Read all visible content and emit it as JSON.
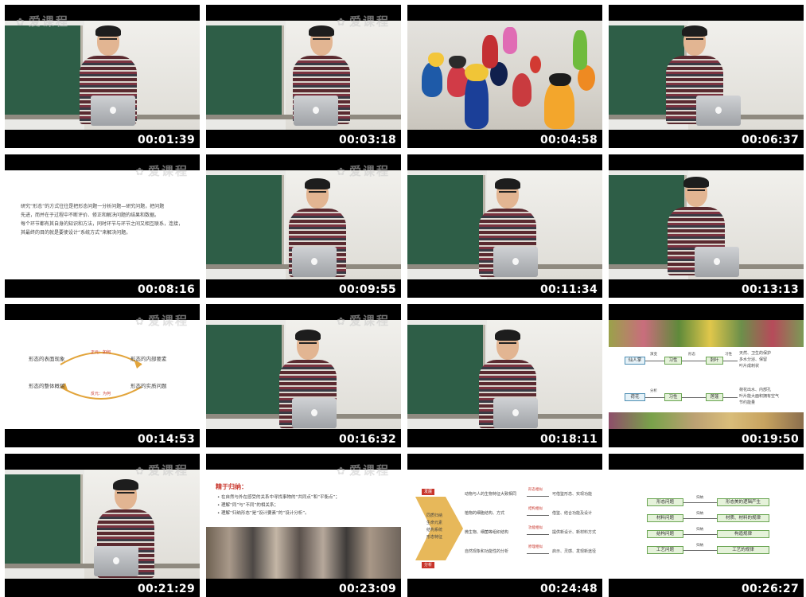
{
  "watermark": "爱课程",
  "timestamps": [
    "00:01:39",
    "00:03:18",
    "00:04:58",
    "00:06:37",
    "00:08:16",
    "00:09:55",
    "00:11:34",
    "00:13:13",
    "00:14:53",
    "00:16:32",
    "00:18:11",
    "00:19:50",
    "00:21:29",
    "00:23:09",
    "00:24:48",
    "00:26:27"
  ],
  "slide_8_16": {
    "lines": [
      "研究“形态”的方式往往是把形态问题一分析问题—研究问题，把问题",
      "先进，而并在于过程中不断评价、修正和解决问题的结果和数据。",
      "每个环节都有其自身的知识和方法，同时环节与环节之间又相互联系，连接，",
      "其最终的目的就是要使设计“系统方式”来解决问题。"
    ]
  },
  "slide_14_53": {
    "left_top": "形态的表面现象",
    "right_top": "形态的内部要素",
    "left_bottom": "形态的整体概貌",
    "right_bottom": "形态的实质问题",
    "arc_top": "正元：如何",
    "arc_bottom": "反元：为何"
  },
  "slide_19_50": {
    "row1": [
      "仙人掌",
      "习性",
      "刺叶"
    ],
    "row1_notes": [
      "天然、卫生的保护",
      "多水分泌、保留",
      "叶片成刺状"
    ],
    "row2": [
      "荷花",
      "习性",
      "莲蓬"
    ],
    "row2_notes": [
      "荷花出水、内部孔",
      "叶片能大面积拥有空气",
      "节约能量"
    ],
    "arrow_labels": [
      "演变",
      "形态",
      "习性",
      "分析"
    ]
  },
  "slide_23_09": {
    "title": "精于归纳：",
    "bullets": [
      "• 在自然与外在感受的关系中寻找事物的“共同点”和“平衡点”；",
      "• 理解“同”与“不同”的相关系；",
      "• 理解“归纳形态”是“设计要素”的“设计分析”。"
    ]
  },
  "slide_24_48": {
    "left_tag_top": "发展",
    "left_tag_bottom": "分析",
    "center_lines": [
      "同质归纳",
      "生命元素",
      "结构系统",
      "形态特征"
    ],
    "rows": [
      {
        "text": "动物与人的生物特征大致相同",
        "tag": "形态相似",
        "result": "可借鉴形态、实现功能"
      },
      {
        "text": "植物的细胞结构、方式",
        "tag": "结构相似",
        "result": "借鉴、结合功能及设计"
      },
      {
        "text": "微生物、细菌等组织结构",
        "tag": "功能相似",
        "result": "提供新设计、新材料方式"
      },
      {
        "text": "自然现象和功能性的分析",
        "tag": "原理相似",
        "result": "启示、灵感、发现新途径"
      }
    ]
  },
  "slide_26_27": {
    "left": [
      "形态问题",
      "材料问题",
      "结构问题",
      "工艺问题"
    ],
    "mid": [
      "归纳",
      "归纳",
      "归纳",
      "归纳"
    ],
    "right": [
      "形态美的逻辑产生",
      "材质、材料的规律",
      "构造规律",
      "工艺的规律"
    ]
  },
  "colors": {
    "background": "#ffffff",
    "frame": "#000000",
    "timestamp": "#ffffff",
    "chalkboard": "#2e5e47",
    "accent_red": "#c8352b",
    "diagram_blue": "#4f8fb4",
    "diagram_green": "#6aa552"
  }
}
